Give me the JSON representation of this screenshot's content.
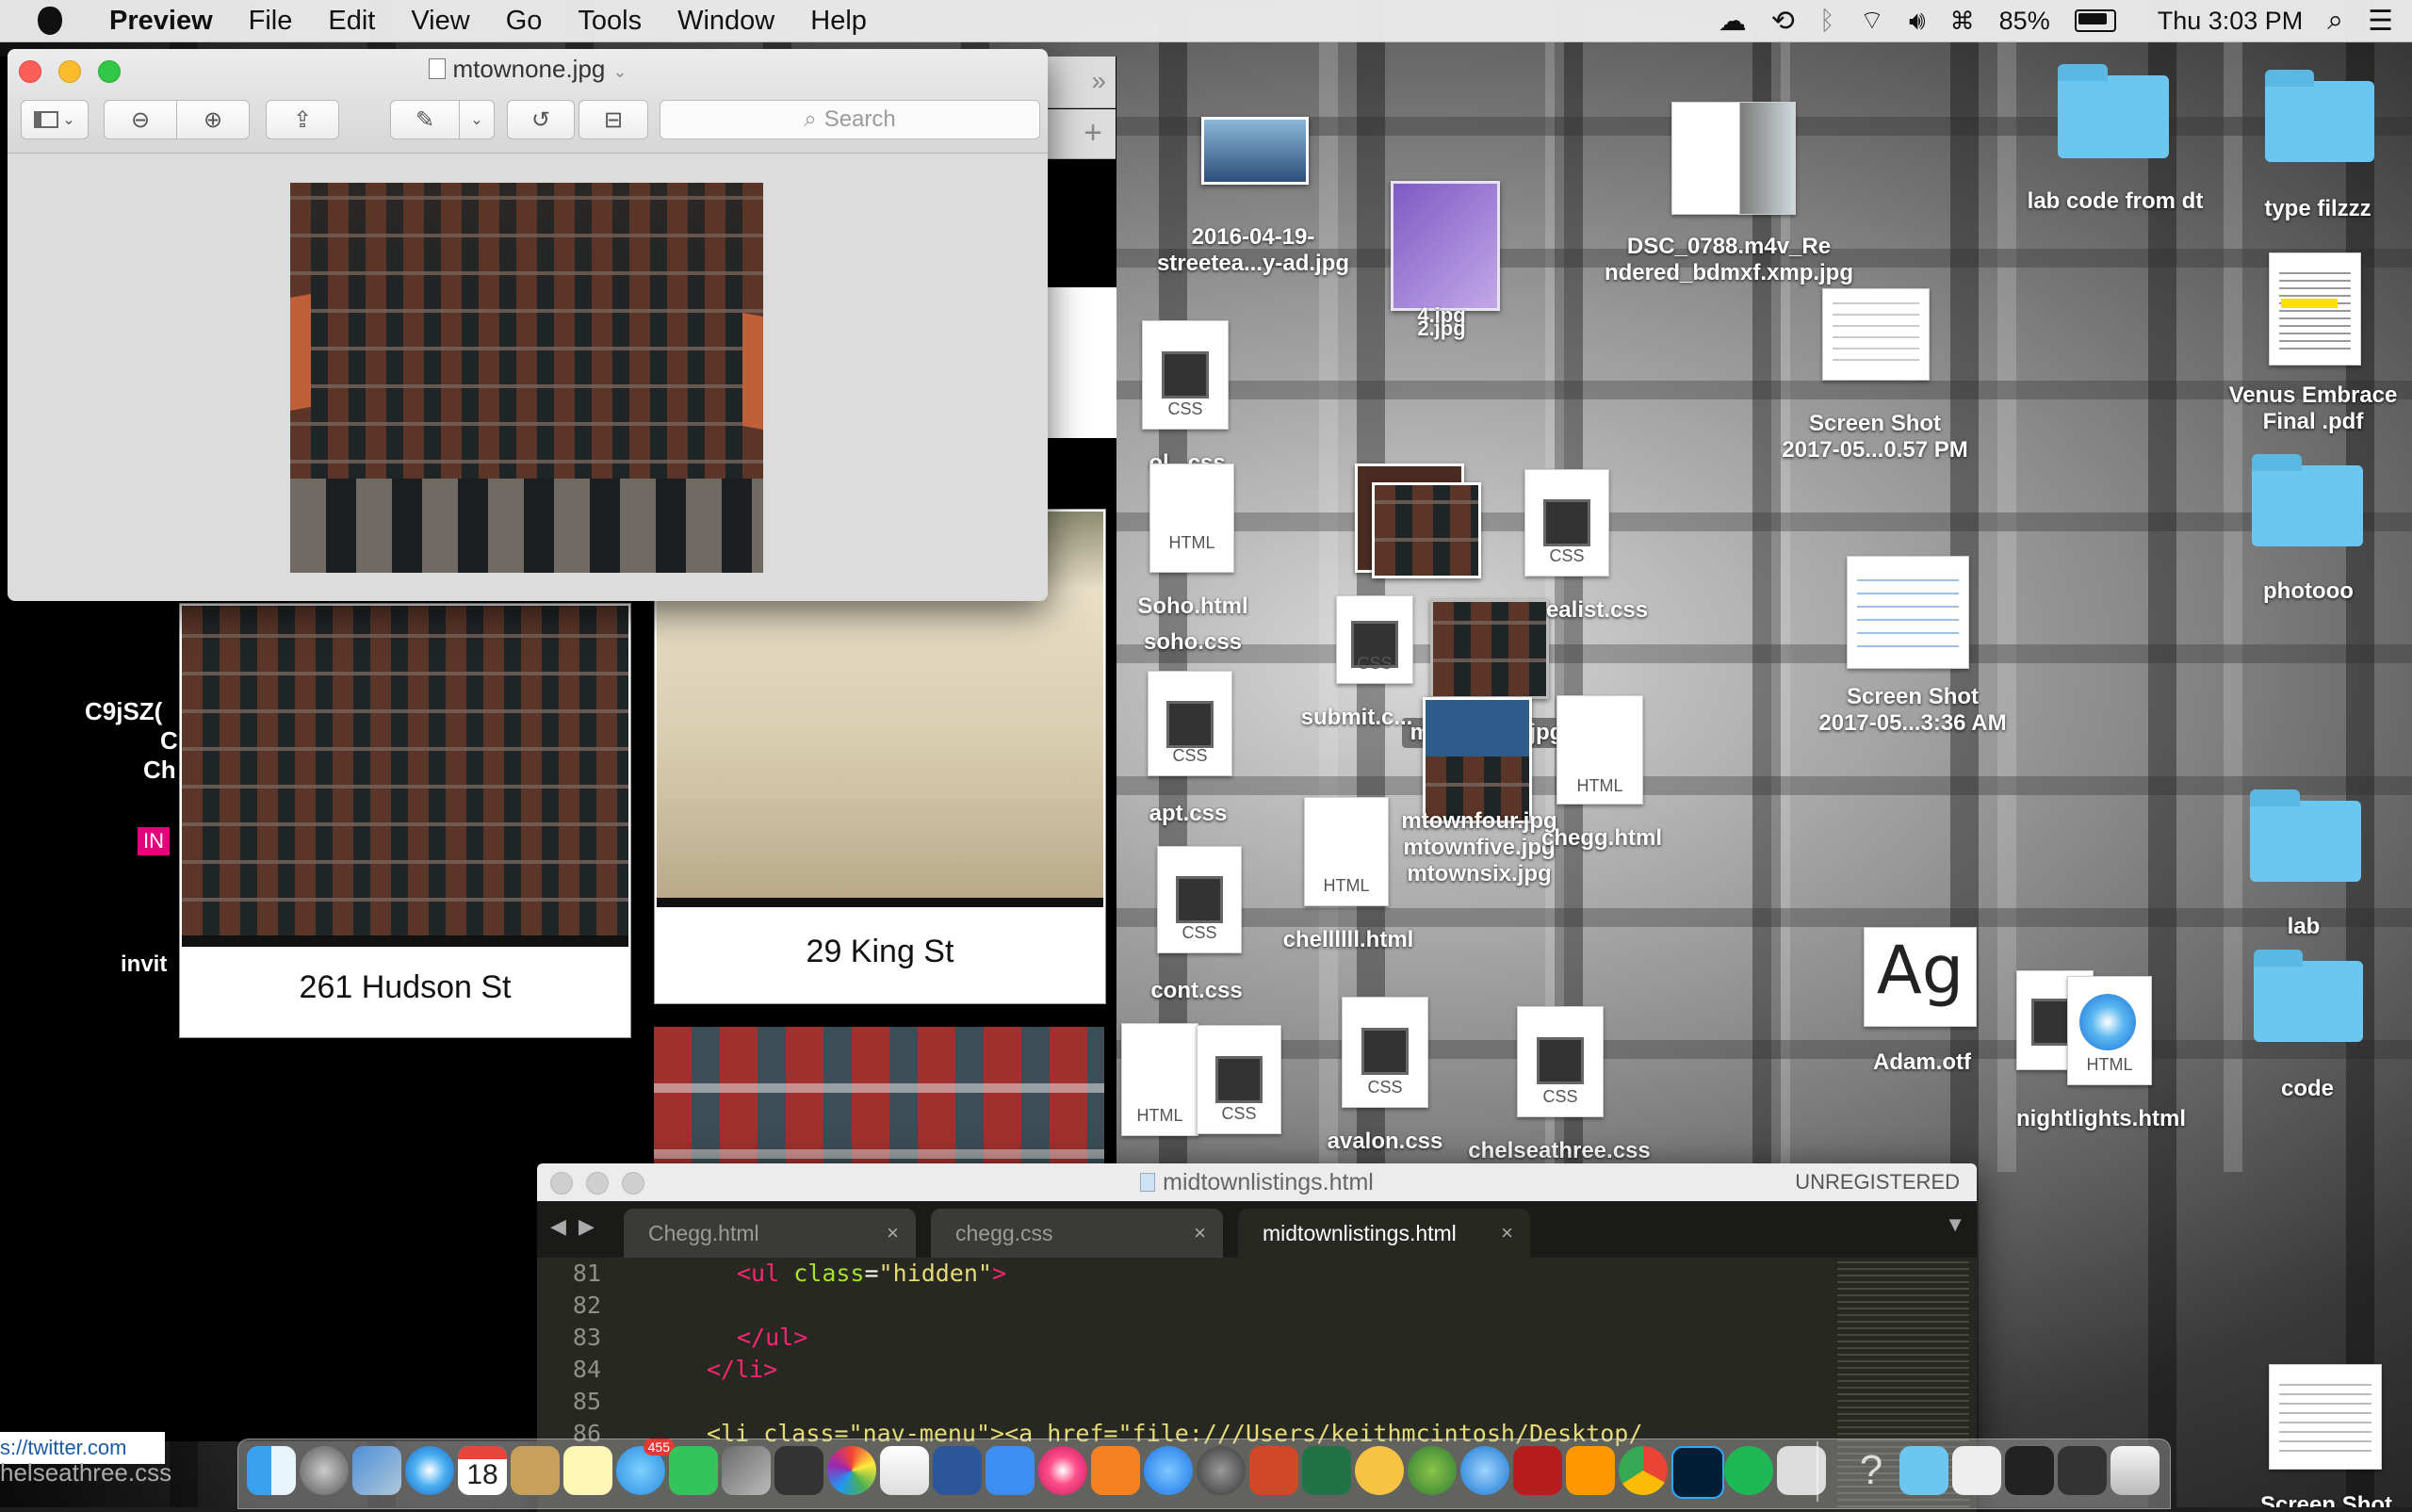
{
  "menubar": {
    "app_name": "Preview",
    "menus": [
      "File",
      "Edit",
      "View",
      "Go",
      "Tools",
      "Window",
      "Help"
    ],
    "battery": "85%",
    "clock": "Thu 3:03 PM"
  },
  "preview_window": {
    "title": "mtownone.jpg",
    "search_placeholder": "Search"
  },
  "browser_page": {
    "cards": [
      {
        "caption": "261 Hudson St"
      },
      {
        "caption": "29 King St"
      }
    ],
    "side_text_1": "C9jSZ(",
    "side_text_2": "C",
    "side_text_3": "Ch",
    "badge": "IN",
    "invite": "invit",
    "status_url": "s://twitter.com",
    "status_file": "helseathree.css"
  },
  "desktop_icons": [
    {
      "label": "2016-04-19-\nstreetea...y-ad.jpg"
    },
    {
      "label": "4.jpg\n2.jpg"
    },
    {
      "label": "DSC_0788.m4v_Re\nndered_bdmxf.xmp.jpg"
    },
    {
      "label": "lab code from dt"
    },
    {
      "label": "type filzzz"
    },
    {
      "label": "Screen Shot\n2017-05...0.57 PM"
    },
    {
      "label": "Venus Embrace\nFinal .pdf"
    },
    {
      "label": "ol...css"
    },
    {
      "label": "Soho.html"
    },
    {
      "label": "soho.css"
    },
    {
      "label": "photooo"
    },
    {
      "label": "mtownone.jpg"
    },
    {
      "label": "ealist.css"
    },
    {
      "label": "submit.c..."
    },
    {
      "label": "Screen Shot\n2017-05...3:36 AM"
    },
    {
      "label": "apt.css"
    },
    {
      "label": "mtownfour.jpg\nmtownfive.jpg\nmtownsix.jpg"
    },
    {
      "label": "chegg.html"
    },
    {
      "label": "chellllll.html"
    },
    {
      "label": "lab"
    },
    {
      "label": "cont.css"
    },
    {
      "label": "Adam.otf"
    },
    {
      "label": "nightlights.html"
    },
    {
      "label": "code"
    },
    {
      "label": "avalon.css"
    },
    {
      "label": "chelseathree.css"
    },
    {
      "label": "Screen Shot"
    }
  ],
  "doc_tags": {
    "css": "CSS",
    "html": "HTML"
  },
  "sublime": {
    "title": "midtownlistings.html",
    "unregistered": "UNREGISTERED",
    "tabs": [
      {
        "label": "Chegg.html"
      },
      {
        "label": "chegg.css"
      },
      {
        "label": "midtownlistings.html"
      }
    ],
    "line_numbers": [
      "81",
      "82",
      "83",
      "84",
      "85",
      "86"
    ],
    "code": {
      "l81_a": "<ul ",
      "l81_b": "class",
      "l81_c": "=",
      "l81_d": "\"hidden\"",
      "l81_e": ">",
      "l83": "</ul>",
      "l84": "</li>",
      "l86": "<li class=\"nav-menu\"><a href=\"file:///Users/keithmcintosh/Desktop/"
    }
  },
  "dock": {
    "calendar_day": "18",
    "messages_badge": "455"
  }
}
